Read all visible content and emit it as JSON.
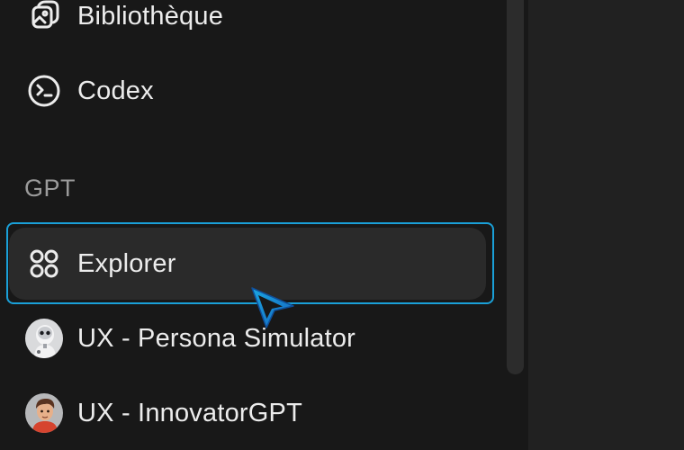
{
  "sidebar": {
    "items": [
      {
        "label": "Bibliothèque",
        "icon": "library-icon"
      },
      {
        "label": "Codex",
        "icon": "terminal-icon"
      }
    ],
    "gpt_section": {
      "label": "GPT",
      "items": [
        {
          "label": "Explorer",
          "icon": "grid-dots-icon",
          "selected": true
        },
        {
          "label": "UX - Persona Simulator",
          "icon": "robot-avatar-icon"
        },
        {
          "label": "UX - InnovatorGPT",
          "icon": "person-avatar-icon"
        }
      ]
    }
  },
  "colors": {
    "sidebar_bg": "#181818",
    "main_bg": "#212121",
    "selected_item_bg": "#2a2a2a",
    "focus_ring": "#1aa0d8",
    "cursor": "#1e7fc7",
    "text": "#ececec",
    "section_label": "#9b9b9b"
  }
}
